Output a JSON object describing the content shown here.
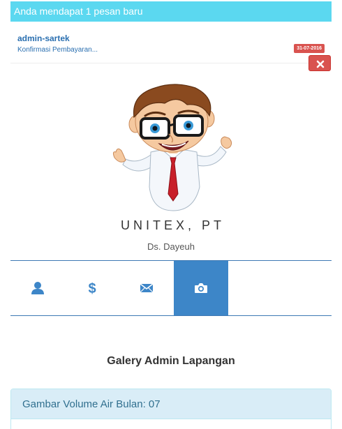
{
  "notification": {
    "text": "Anda mendapat 1 pesan baru"
  },
  "message": {
    "sender": "admin-sartek",
    "preview": "Konfirmasi Pembayaran...",
    "date": "31-07-2016",
    "delete_icon": "close-icon"
  },
  "profile": {
    "avatar": "cartoon-man-with-glasses",
    "company": "UNITEX, PT",
    "address": "Ds. Dayeuh"
  },
  "tabs": [
    {
      "icon": "user-icon",
      "active": false
    },
    {
      "icon": "dollar-icon",
      "active": false
    },
    {
      "icon": "envelope-icon",
      "active": false
    },
    {
      "icon": "camera-icon",
      "active": true
    }
  ],
  "gallery": {
    "title": "Galery Admin Lapangan",
    "panel_heading": "Gambar Volume Air Bulan: 07"
  },
  "colors": {
    "notification_bg": "#5bd8f0",
    "accent": "#3d86c8",
    "danger": "#d9534f",
    "panel_heading_bg": "#d9edf7"
  }
}
